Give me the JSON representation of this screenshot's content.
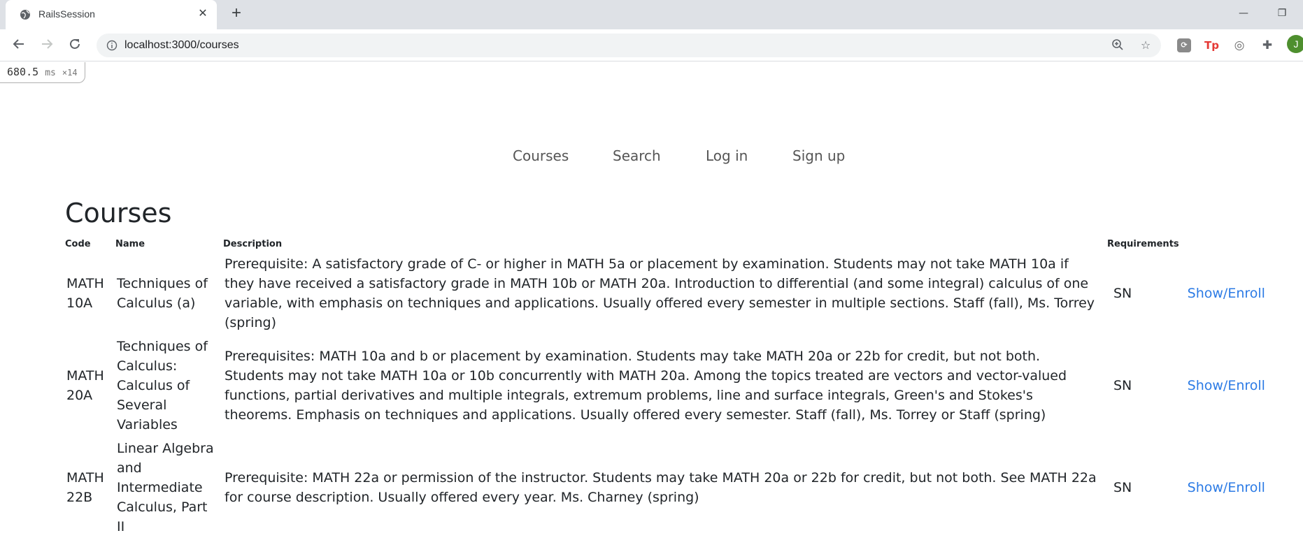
{
  "browser": {
    "tab_title": "RailsSession",
    "url": "localhost:3000/courses",
    "avatar_letter": "J"
  },
  "profiler": {
    "time": "680.5",
    "unit": "ms",
    "count": "×14"
  },
  "nav": {
    "items": [
      {
        "label": "Courses"
      },
      {
        "label": "Search"
      },
      {
        "label": "Log in"
      },
      {
        "label": "Sign up"
      }
    ]
  },
  "page": {
    "title": "Courses"
  },
  "table": {
    "headers": {
      "code": "Code",
      "name": "Name",
      "description": "Description",
      "requirements": "Requirements"
    },
    "rows": [
      {
        "code": "MATH 10A",
        "name": "Techniques of Calculus (a)",
        "description": "Prerequisite: A satisfactory grade of C- or higher in MATH 5a or placement by examination. Students may not take MATH 10a if they have received a satisfactory grade in MATH 10b or MATH 20a. Introduction to differential (and some integral) calculus of one variable, with emphasis on techniques and applications. Usually offered every semester in multiple sections. Staff (fall), Ms. Torrey (spring)",
        "requirements": "SN",
        "action": "Show/Enroll"
      },
      {
        "code": "MATH 20A",
        "name": "Techniques of Calculus: Calculus of Several Variables",
        "description": "Prerequisites: MATH 10a and b or placement by examination. Students may take MATH 20a or 22b for credit, but not both. Students may not take MATH 10a or 10b concurrently with MATH 20a. Among the topics treated are vectors and vector-valued functions, partial derivatives and multiple integrals, extremum problems, line and surface integrals, Green's and Stokes's theorems. Emphasis on techniques and applications. Usually offered every semester. Staff (fall), Ms. Torrey or Staff (spring)",
        "requirements": "SN",
        "action": "Show/Enroll"
      },
      {
        "code": "MATH 22B",
        "name": "Linear Algebra and Intermediate Calculus, Part II",
        "description": "Prerequisite: MATH 22a or permission of the instructor. Students may take MATH 20a or 22b for credit, but not both. See MATH 22a for course description. Usually offered every year. Ms. Charney (spring)",
        "requirements": "SN",
        "action": "Show/Enroll"
      }
    ]
  }
}
